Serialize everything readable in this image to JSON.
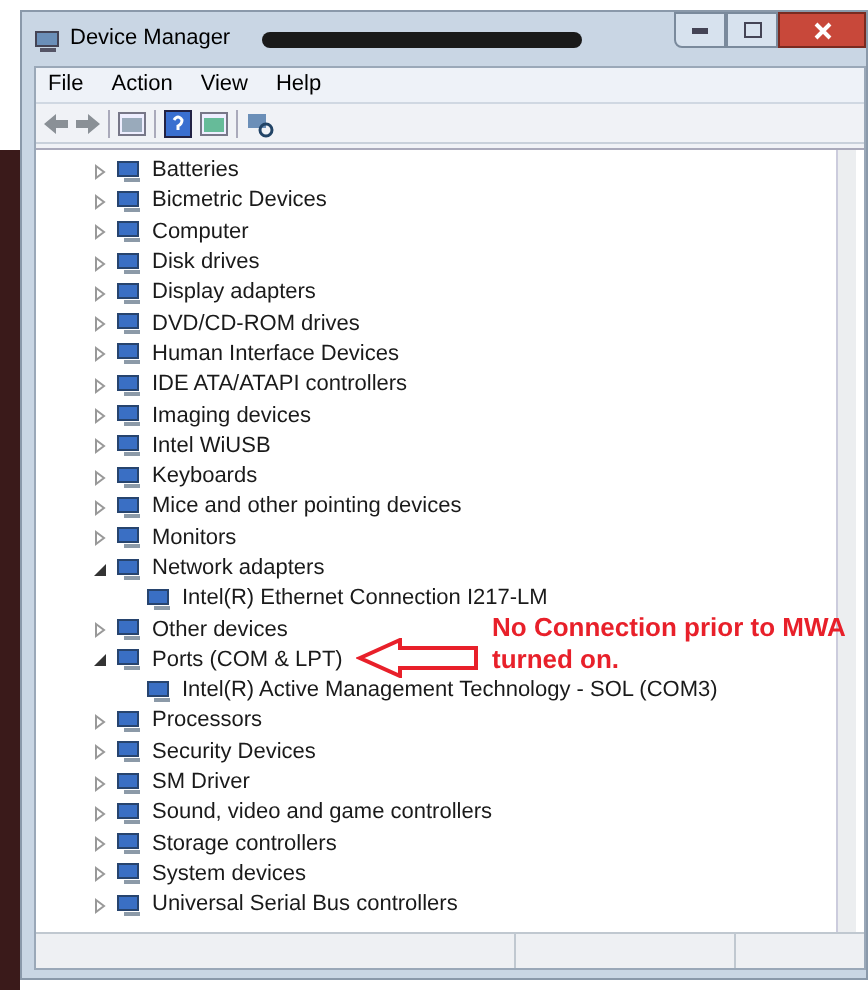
{
  "window": {
    "title": "Device Manager"
  },
  "menu": [
    "File",
    "Action",
    "View",
    "Help"
  ],
  "tree": [
    {
      "label": "Batteries",
      "expanded": false
    },
    {
      "label": "Bicmetric Devices",
      "expanded": false
    },
    {
      "label": "Computer",
      "expanded": false
    },
    {
      "label": "Disk drives",
      "expanded": false
    },
    {
      "label": "Display adapters",
      "expanded": false
    },
    {
      "label": "DVD/CD-ROM drives",
      "expanded": false
    },
    {
      "label": "Human Interface Devices",
      "expanded": false
    },
    {
      "label": "IDE ATA/ATAPI controllers",
      "expanded": false
    },
    {
      "label": "Imaging devices",
      "expanded": false
    },
    {
      "label": "Intel WiUSB",
      "expanded": false
    },
    {
      "label": "Keyboards",
      "expanded": false
    },
    {
      "label": "Mice and other pointing devices",
      "expanded": false
    },
    {
      "label": "Monitors",
      "expanded": false
    },
    {
      "label": "Network adapters",
      "expanded": true,
      "children": [
        {
          "label": "Intel(R) Ethernet Connection I217-LM"
        }
      ]
    },
    {
      "label": "Other devices",
      "expanded": false
    },
    {
      "label": "Ports (COM & LPT)",
      "expanded": true,
      "children": [
        {
          "label": "Intel(R) Active Management Technology - SOL (COM3)"
        }
      ]
    },
    {
      "label": "Processors",
      "expanded": false
    },
    {
      "label": "Security Devices",
      "expanded": false
    },
    {
      "label": "SM Driver",
      "expanded": false
    },
    {
      "label": "Sound, video and game controllers",
      "expanded": false
    },
    {
      "label": "Storage controllers",
      "expanded": false
    },
    {
      "label": "System devices",
      "expanded": false
    },
    {
      "label": "Universal Serial Bus controllers",
      "expanded": false
    }
  ],
  "annotation": {
    "lines": [
      "No Connection prior to MWA",
      "turned on."
    ]
  }
}
